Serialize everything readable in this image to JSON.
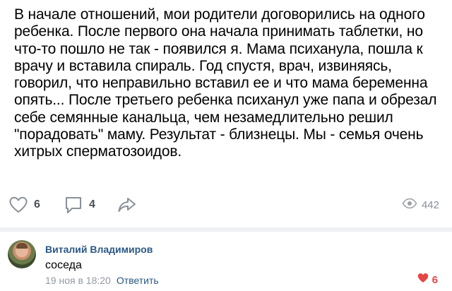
{
  "post": {
    "text_lines": [
      "В начале отношений, мои родители договорились на одного",
      "ребенка. После первого она начала принимать таблетки, но",
      "что-то пошло не так - появился я. Мама психанула, пошла к",
      "врачу и вставила спираль. Год спустя, врач, извиняясь,",
      "говорил, что неправильно вставил ее и что мама беременна",
      "опять... После третьего ребенка психанул уже папа и обрезал",
      "себе семянные канальца, чем незамедлительно решил",
      "\"порадовать\" маму. Результат - близнецы. Мы - семья очень",
      "хитрых сперматозоидов."
    ],
    "likes_count": "6",
    "comments_count": "4",
    "views_count": "442",
    "icons": {
      "like": "heart-outline-icon",
      "comment": "speech-bubble-icon",
      "share": "share-arrow-icon",
      "views": "eye-icon"
    }
  },
  "comment": {
    "author": "Виталий Владимиров",
    "text": "соседа",
    "date": "19 ноя в 18:20",
    "reply_label": "Ответить",
    "likes_count": "6",
    "like_icon": "heart-filled-icon"
  },
  "colors": {
    "link": "#2a5885",
    "meta": "#939aa3",
    "like_active": "#e64646",
    "divider": "#eef0f3"
  }
}
